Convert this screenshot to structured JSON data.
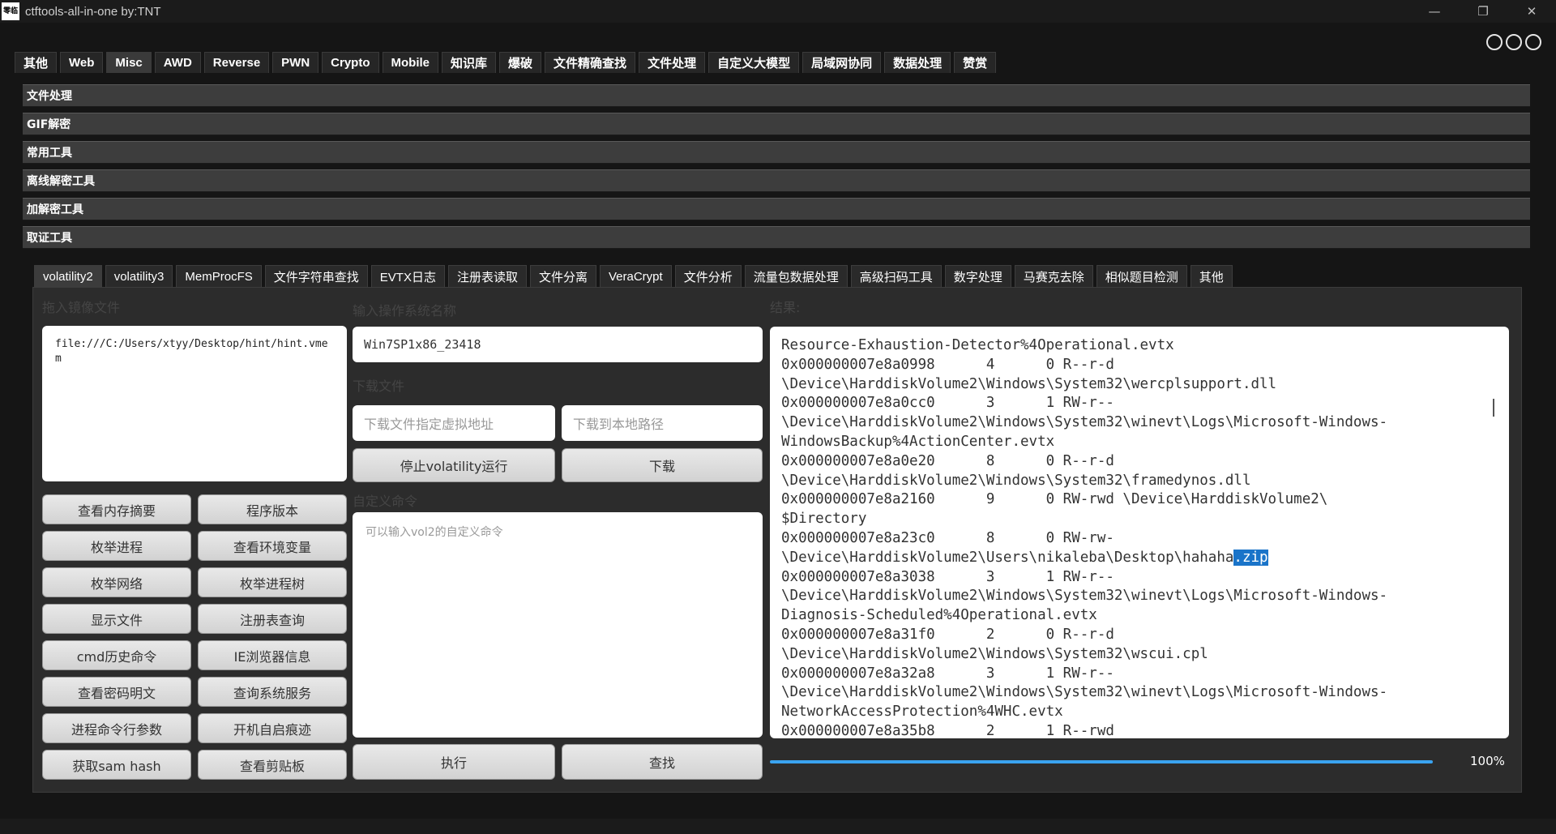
{
  "window": {
    "logo_text": "零临",
    "title": "ctftools-all-in-one   by:TNT",
    "controls": [
      "—",
      "❐",
      "✕"
    ]
  },
  "main_tabs": [
    {
      "label": "其他"
    },
    {
      "label": "Web"
    },
    {
      "label": "Misc",
      "active": true
    },
    {
      "label": "AWD"
    },
    {
      "label": "Reverse"
    },
    {
      "label": "PWN"
    },
    {
      "label": "Crypto"
    },
    {
      "label": "Mobile"
    },
    {
      "label": "知识库"
    },
    {
      "label": "爆破"
    },
    {
      "label": "文件精确查找"
    },
    {
      "label": "文件处理"
    },
    {
      "label": "自定义大模型"
    },
    {
      "label": "局域网协同"
    },
    {
      "label": "数据处理"
    },
    {
      "label": "赞赏"
    }
  ],
  "sections": [
    {
      "label": "文件处理"
    },
    {
      "label": "GIF解密"
    },
    {
      "label": "常用工具"
    },
    {
      "label": "离线解密工具"
    },
    {
      "label": "加解密工具"
    },
    {
      "label": "取证工具"
    }
  ],
  "sub_tabs": [
    {
      "label": "volatility2",
      "active": true
    },
    {
      "label": "volatility3"
    },
    {
      "label": "MemProcFS"
    },
    {
      "label": "文件字符串查找"
    },
    {
      "label": "EVTX日志"
    },
    {
      "label": "注册表读取"
    },
    {
      "label": "文件分离"
    },
    {
      "label": "VeraCrypt"
    },
    {
      "label": "文件分析"
    },
    {
      "label": "流量包数据处理"
    },
    {
      "label": "高级扫码工具"
    },
    {
      "label": "数字处理"
    },
    {
      "label": "马赛克去除"
    },
    {
      "label": "相似题目检测"
    },
    {
      "label": "其他"
    }
  ],
  "labels": {
    "image_file": "拖入镜像文件",
    "os_name": "输入操作系统名称",
    "download_file": "下载文件",
    "custom_cmd": "自定义命令",
    "result": "结果:"
  },
  "file_path": "file:///C:/Users/xtyy/Desktop/hint/hint.vmem",
  "left_buttons": [
    [
      "查看内存摘要",
      "程序版本"
    ],
    [
      "枚举进程",
      "查看环境变量"
    ],
    [
      "枚举网络",
      "枚举进程树"
    ],
    [
      "显示文件",
      "注册表查询"
    ],
    [
      "cmd历史命令",
      "IE浏览器信息"
    ],
    [
      "查看密码明文",
      "查询系统服务"
    ],
    [
      "进程命令行参数",
      "开机自启痕迹"
    ],
    [
      "获取sam hash",
      "查看剪贴板"
    ]
  ],
  "os_input_value": "Win7SP1x86_23418",
  "download": {
    "addr_placeholder": "下载文件指定虚拟地址",
    "path_placeholder": "下载到本地路径",
    "stop_label": "停止volatility运行",
    "download_label": "下载"
  },
  "custom_cmd_placeholder": "可以输入vol2的自定义命令",
  "actions": {
    "execute": "执行",
    "search": "查找"
  },
  "result_lines": [
    "Resource-Exhaustion-Detector%4Operational.evtx",
    "0x000000007e8a0998      4      0 R--r-d",
    "\\Device\\HarddiskVolume2\\Windows\\System32\\wercplsupport.dll",
    "0x000000007e8a0cc0      3      1 RW-r--",
    "\\Device\\HarddiskVolume2\\Windows\\System32\\winevt\\Logs\\Microsoft-Windows-",
    "WindowsBackup%4ActionCenter.evtx",
    "0x000000007e8a0e20      8      0 R--r-d",
    "\\Device\\HarddiskVolume2\\Windows\\System32\\framedynos.dll",
    "0x000000007e8a2160      9      0 RW-rwd \\Device\\HarddiskVolume2\\",
    "$Directory",
    "0x000000007e8a23c0      8      0 RW-rw-",
    "0x000000007e8a3038      3      1 RW-r--",
    "\\Device\\HarddiskVolume2\\Windows\\System32\\winevt\\Logs\\Microsoft-Windows-",
    "Diagnosis-Scheduled%4Operational.evtx",
    "0x000000007e8a31f0      2      0 R--r-d",
    "\\Device\\HarddiskVolume2\\Windows\\System32\\wscui.cpl",
    "0x000000007e8a32a8      3      1 RW-r--",
    "\\Device\\HarddiskVolume2\\Windows\\System32\\winevt\\Logs\\Microsoft-Windows-",
    "NetworkAccessProtection%4WHC.evtx",
    "0x000000007e8a35b8      2      1 R--rwd"
  ],
  "result_highlight_line": {
    "before": "\\Device\\HarddiskVolume2\\Users\\nikaleba\\Desktop\\hahaha",
    "selected": ".zip"
  },
  "progress": {
    "value": 1.0,
    "label": "100%"
  },
  "colors": {
    "accent": "#3aa3f0",
    "selection": "#1a74c9",
    "background": "#151515"
  }
}
